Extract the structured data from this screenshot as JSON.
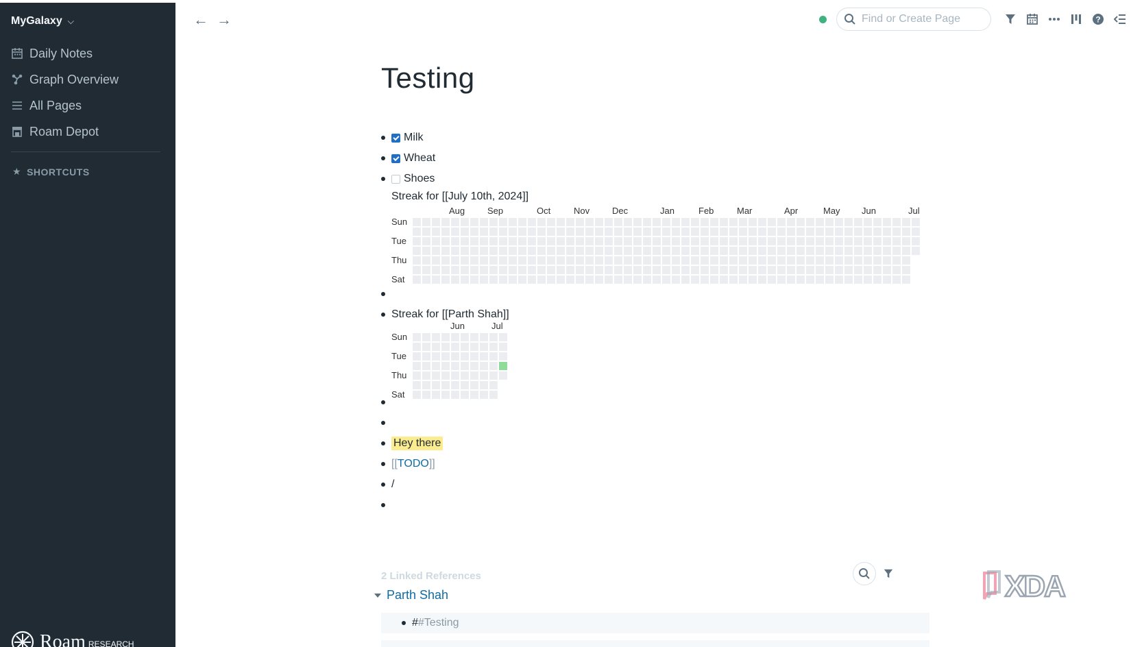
{
  "sidebar": {
    "graph_name": "MyGalaxy",
    "items": [
      {
        "label": "Daily Notes",
        "icon": "calendar-icon"
      },
      {
        "label": "Graph Overview",
        "icon": "graph-icon"
      },
      {
        "label": "All Pages",
        "icon": "list-icon"
      },
      {
        "label": "Roam Depot",
        "icon": "store-icon"
      }
    ],
    "shortcuts_label": "SHORTCUTS",
    "logo_wordmark": "Roam",
    "logo_sub": "RESEARCH"
  },
  "topbar": {
    "search_placeholder": "Find or Create Page",
    "status_color": "#3fb27f"
  },
  "page": {
    "title": "Testing",
    "todos": [
      {
        "label": "Milk",
        "checked": true
      },
      {
        "label": "Wheat",
        "checked": true
      },
      {
        "label": "Shoes",
        "checked": false
      }
    ],
    "streak1": {
      "title": "Streak for [[July 10th, 2024]]",
      "months": [
        "Aug",
        "Sep",
        "Oct",
        "Nov",
        "Dec",
        "Jan",
        "Feb",
        "Mar",
        "Apr",
        "May",
        "Jun",
        "Jul"
      ],
      "days": [
        "Sun",
        "Tue",
        "Thu",
        "Sat"
      ]
    },
    "streak2": {
      "title": "Streak for [[Parth Shah]]",
      "months": [
        "Jun",
        "Jul"
      ],
      "days": [
        "Sun",
        "Tue",
        "Thu",
        "Sat"
      ]
    },
    "highlight_text": "Hey there",
    "todo_open": "[[",
    "todo_tag": "TODO",
    "todo_close": "]]",
    "slash": "/"
  },
  "linked": {
    "title": "2 Linked References",
    "group": "Parth Shah",
    "ref_hash": "#",
    "ref_tag": "#Testing"
  },
  "colors": {
    "sidebar_bg": "#202b33",
    "heat_empty": "#ebedf0",
    "heat_hit": "#8fdc9a",
    "highlight": "#fbec8f",
    "link": "#106ba3"
  }
}
